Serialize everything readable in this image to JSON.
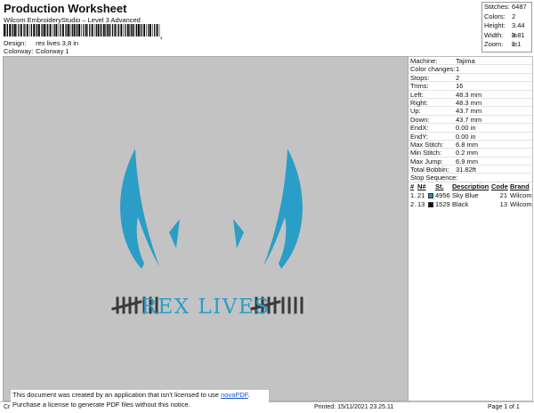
{
  "header": {
    "title": "Production Worksheet",
    "subtitle": "Wilcom EmbroideryStudio – Level 3 Advanced",
    "barcode_sep": ",",
    "design_label": "Design:",
    "design_value": "rex lives 3,8 in",
    "colorway_label": "Colorway:",
    "colorway_value": "Colorway 1"
  },
  "stats": [
    {
      "k": "Stitches:",
      "v": "6487"
    },
    {
      "k": "Colors:",
      "v": "2"
    },
    {
      "k": "Height:",
      "v": "3.44 in"
    },
    {
      "k": "Width:",
      "v": "3.81 in"
    },
    {
      "k": "Zoom:",
      "v": "1:1"
    }
  ],
  "machine": [
    {
      "k": "Machine:",
      "v": "Tajima"
    },
    {
      "k": "Color changes:",
      "v": "1"
    },
    {
      "k": "Stops:",
      "v": "2"
    },
    {
      "k": "Trims:",
      "v": "16"
    },
    {
      "k": "Left:",
      "v": "48.3 mm"
    },
    {
      "k": "Right:",
      "v": "48.3 mm"
    },
    {
      "k": "Up:",
      "v": "43.7 mm"
    },
    {
      "k": "Down:",
      "v": "43.7 mm"
    },
    {
      "k": "EndX:",
      "v": "0.00 in"
    },
    {
      "k": "EndY:",
      "v": "0.00 in"
    },
    {
      "k": "Max Stitch:",
      "v": "6.8 mm"
    },
    {
      "k": "Min Stitch:",
      "v": "0.2 mm"
    },
    {
      "k": "Max Jump:",
      "v": "6.9 mm"
    },
    {
      "k": "Total Bobbin:",
      "v": "31.82ft"
    }
  ],
  "stop_sequence": {
    "title": "Stop Sequence:",
    "columns": [
      "#",
      "N#",
      "St.",
      "Description",
      "Code",
      "Brand"
    ],
    "rows": [
      {
        "num": "1.",
        "n": "21",
        "color": "#1e8fbf",
        "st": "4956",
        "desc": "Sky Blue",
        "code": "21",
        "brand": "Wilcom"
      },
      {
        "num": "2.",
        "n": "13",
        "color": "#111111",
        "st": "1529",
        "desc": "Black",
        "code": "13",
        "brand": "Wilcom"
      }
    ]
  },
  "design": {
    "text": "REX LIVES",
    "primary_color": "#2a9ec6",
    "secondary_color": "#3a3a3a",
    "background": "#c3c3c3"
  },
  "notice": {
    "line1_a": "This document was created by an application that isn't licensed to use ",
    "line1_link": "novaPDF",
    "line1_b": ".",
    "line2": "Purchase a license to generate PDF files without this notice."
  },
  "footer": {
    "cr": "Cr",
    "printed": "Printed: 15/11/2021 23.25.11",
    "page": "Page 1 of 1"
  }
}
